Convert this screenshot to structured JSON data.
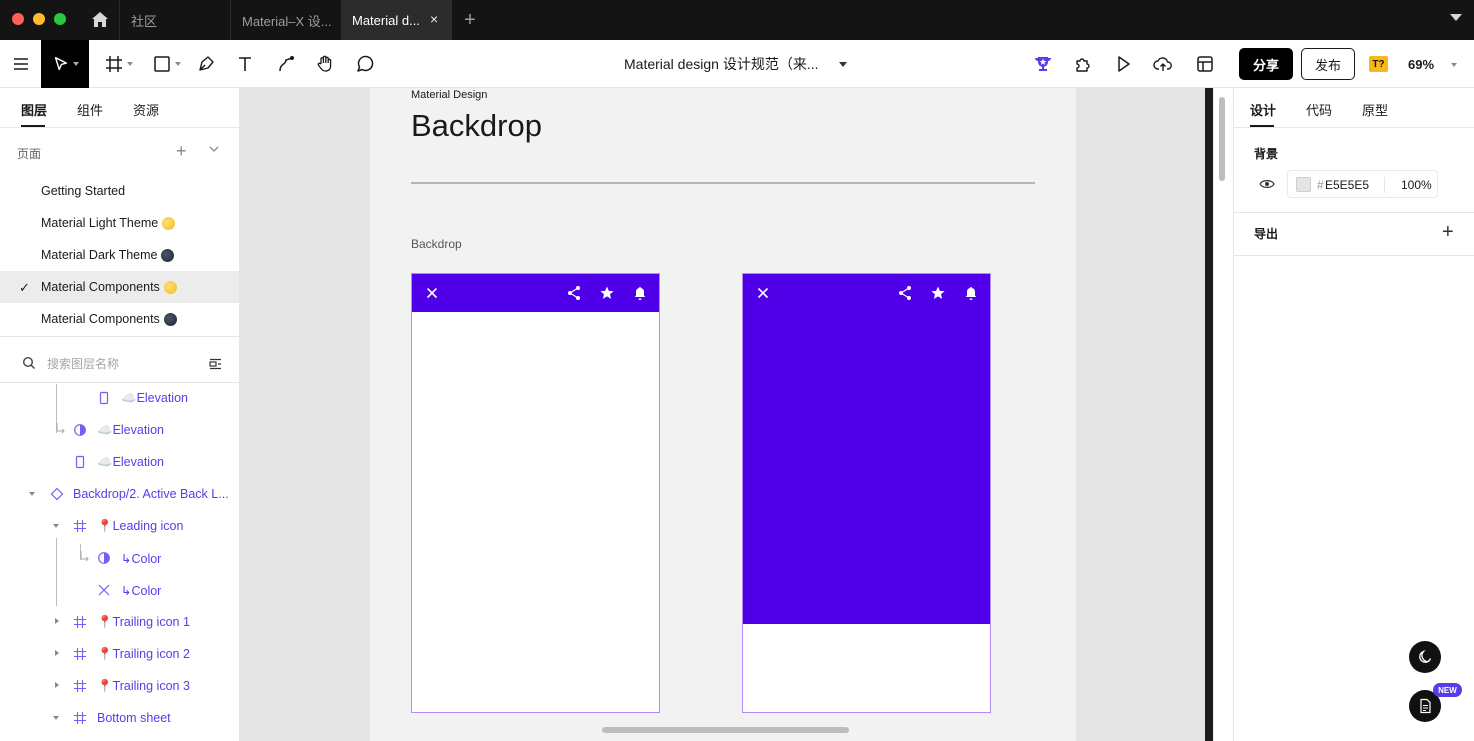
{
  "titlebar": {
    "tabs": [
      {
        "label": "社区"
      },
      {
        "label": "Material–X 设..."
      },
      {
        "label": "Material d..."
      }
    ],
    "close_glyph": "×",
    "add_glyph": "+"
  },
  "toolbar": {
    "doc_title": "Material design 设计规范（来...",
    "share_label": "分享",
    "publish_label": "发布",
    "badge_label": "T?",
    "zoom": "69%"
  },
  "left_panel": {
    "tabs": [
      "图层",
      "组件",
      "资源"
    ],
    "pages_label": "页面",
    "pages": [
      {
        "label": "Getting Started",
        "emoji": ""
      },
      {
        "label": "Material Light Theme",
        "emoji": "sun"
      },
      {
        "label": "Material Dark Theme",
        "emoji": "moon"
      },
      {
        "label": "Material Components",
        "emoji": "sun",
        "selected": true
      },
      {
        "label": "Material Components",
        "emoji": "moon"
      }
    ],
    "search_placeholder": "搜索图层名称",
    "layers": [
      {
        "label": "☁️Elevation",
        "icon": "rectangle-icon"
      },
      {
        "label": "☁️Elevation",
        "icon": "half-circle-icon"
      },
      {
        "label": "☁️Elevation",
        "icon": "rectangle-icon"
      },
      {
        "label": "Backdrop/2. Active Back L...",
        "icon": "component-instance-icon"
      },
      {
        "label": "📍Leading icon",
        "icon": "frame-icon"
      },
      {
        "label": "↳Color",
        "icon": "half-circle-icon"
      },
      {
        "label": "↳Color",
        "icon": "vector-x-icon"
      },
      {
        "label": "📍Trailing icon 1",
        "icon": "frame-icon"
      },
      {
        "label": "📍Trailing icon 2",
        "icon": "frame-icon"
      },
      {
        "label": "📍Trailing icon 3",
        "icon": "frame-icon"
      },
      {
        "label": "Bottom sheet",
        "icon": "frame-icon"
      }
    ]
  },
  "canvas": {
    "frame_small_title": "Material Design",
    "frame_title": "Backdrop",
    "section_label": "Backdrop",
    "colors": {
      "appbar": "#4f00e8",
      "canvas_bg": "#e5e5e5"
    }
  },
  "right_panel": {
    "tabs": [
      "设计",
      "代码",
      "原型"
    ],
    "background_label": "背景",
    "background_hex": "E5E5E5",
    "background_opacity": "100%",
    "export_label": "导出",
    "hash": "#"
  },
  "fab": {
    "new_label": "NEW"
  }
}
